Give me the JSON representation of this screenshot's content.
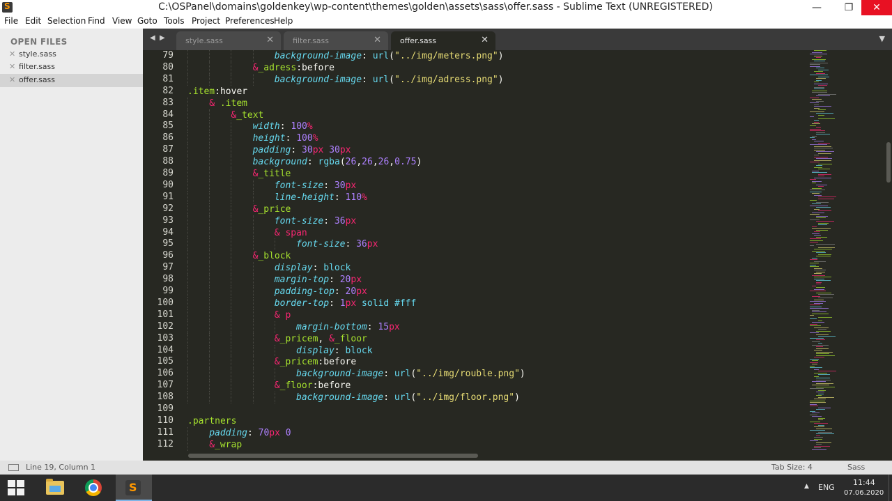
{
  "window": {
    "title": "C:\\OSPanel\\domains\\goldenkey\\wp-content\\themes\\golden\\assets\\sass\\offer.sass - Sublime Text (UNREGISTERED)",
    "minimize": "—",
    "maximize": "❐",
    "close": "✕"
  },
  "menu": [
    "File",
    "Edit",
    "Selection",
    "Find",
    "View",
    "Goto",
    "Tools",
    "Project",
    "Preferences",
    "Help"
  ],
  "sidebar": {
    "title": "OPEN FILES",
    "files": [
      {
        "name": "style.sass",
        "active": false
      },
      {
        "name": "filter.sass",
        "active": false
      },
      {
        "name": "offer.sass",
        "active": true
      }
    ],
    "close_glyph": "✕"
  },
  "tabs": [
    {
      "label": "style.sass",
      "active": false
    },
    {
      "label": "filter.sass",
      "active": false
    },
    {
      "label": "offer.sass",
      "active": true
    }
  ],
  "tab_close_glyph": "✕",
  "tab_nav": {
    "left": "◀",
    "right": "▶",
    "dropdown": "▼"
  },
  "editor": {
    "lines": [
      {
        "n": "79",
        "indent": 4,
        "tokens": [
          [
            "prop",
            "background-image"
          ],
          [
            "pl",
            ": "
          ],
          [
            "fn",
            "url"
          ],
          [
            "pl",
            "("
          ],
          [
            "str",
            "\"../img/meters.png\""
          ],
          [
            "pl",
            ")"
          ]
        ]
      },
      {
        "n": "80",
        "indent": 3,
        "tokens": [
          [
            "amp",
            "&"
          ],
          [
            "sel",
            "_adress"
          ],
          [
            "pl",
            ":before"
          ]
        ]
      },
      {
        "n": "81",
        "indent": 4,
        "tokens": [
          [
            "prop",
            "background-image"
          ],
          [
            "pl",
            ": "
          ],
          [
            "fn",
            "url"
          ],
          [
            "pl",
            "("
          ],
          [
            "str",
            "\"../img/adress.png\""
          ],
          [
            "pl",
            ")"
          ]
        ]
      },
      {
        "n": "82",
        "indent": 0,
        "tokens": [
          [
            "sel",
            ".item"
          ],
          [
            "pl",
            ":hover"
          ]
        ]
      },
      {
        "n": "83",
        "indent": 1,
        "tokens": [
          [
            "amp",
            "& "
          ],
          [
            "sel",
            ".item"
          ]
        ]
      },
      {
        "n": "84",
        "indent": 2,
        "tokens": [
          [
            "amp",
            "&"
          ],
          [
            "sel",
            "_text"
          ]
        ]
      },
      {
        "n": "85",
        "indent": 3,
        "tokens": [
          [
            "prop",
            "width"
          ],
          [
            "pl",
            ": "
          ],
          [
            "num",
            "100"
          ],
          [
            "unit",
            "%"
          ]
        ]
      },
      {
        "n": "86",
        "indent": 3,
        "tokens": [
          [
            "prop",
            "height"
          ],
          [
            "pl",
            ": "
          ],
          [
            "num",
            "100"
          ],
          [
            "unit",
            "%"
          ]
        ]
      },
      {
        "n": "87",
        "indent": 3,
        "tokens": [
          [
            "prop",
            "padding"
          ],
          [
            "pl",
            ": "
          ],
          [
            "num",
            "30"
          ],
          [
            "unit",
            "px"
          ],
          [
            "pl",
            " "
          ],
          [
            "num",
            "30"
          ],
          [
            "unit",
            "px"
          ]
        ]
      },
      {
        "n": "88",
        "indent": 3,
        "tokens": [
          [
            "prop",
            "background"
          ],
          [
            "pl",
            ": "
          ],
          [
            "fn",
            "rgba"
          ],
          [
            "pl",
            "("
          ],
          [
            "num",
            "26"
          ],
          [
            "pl",
            ","
          ],
          [
            "num",
            "26"
          ],
          [
            "pl",
            ","
          ],
          [
            "num",
            "26"
          ],
          [
            "pl",
            ","
          ],
          [
            "num",
            "0.75"
          ],
          [
            "pl",
            ")"
          ]
        ]
      },
      {
        "n": "89",
        "indent": 3,
        "tokens": [
          [
            "amp",
            "&"
          ],
          [
            "sel",
            "_title"
          ]
        ]
      },
      {
        "n": "90",
        "indent": 4,
        "tokens": [
          [
            "prop",
            "font-size"
          ],
          [
            "pl",
            ": "
          ],
          [
            "num",
            "30"
          ],
          [
            "unit",
            "px"
          ]
        ]
      },
      {
        "n": "91",
        "indent": 4,
        "tokens": [
          [
            "prop",
            "line-height"
          ],
          [
            "pl",
            ": "
          ],
          [
            "num",
            "110"
          ],
          [
            "unit",
            "%"
          ]
        ]
      },
      {
        "n": "92",
        "indent": 3,
        "tokens": [
          [
            "amp",
            "&"
          ],
          [
            "sel",
            "_price"
          ]
        ]
      },
      {
        "n": "93",
        "indent": 4,
        "tokens": [
          [
            "prop",
            "font-size"
          ],
          [
            "pl",
            ": "
          ],
          [
            "num",
            "36"
          ],
          [
            "unit",
            "px"
          ]
        ]
      },
      {
        "n": "94",
        "indent": 4,
        "tokens": [
          [
            "amp",
            "& "
          ],
          [
            "amp",
            "span"
          ]
        ]
      },
      {
        "n": "95",
        "indent": 5,
        "tokens": [
          [
            "prop",
            "font-size"
          ],
          [
            "pl",
            ": "
          ],
          [
            "num",
            "36"
          ],
          [
            "unit",
            "px"
          ]
        ]
      },
      {
        "n": "96",
        "indent": 3,
        "tokens": [
          [
            "amp",
            "&"
          ],
          [
            "sel",
            "_block"
          ]
        ]
      },
      {
        "n": "97",
        "indent": 4,
        "tokens": [
          [
            "prop",
            "display"
          ],
          [
            "pl",
            ": "
          ],
          [
            "val",
            "block"
          ]
        ]
      },
      {
        "n": "98",
        "indent": 4,
        "tokens": [
          [
            "prop",
            "margin-top"
          ],
          [
            "pl",
            ": "
          ],
          [
            "num",
            "20"
          ],
          [
            "unit",
            "px"
          ]
        ]
      },
      {
        "n": "99",
        "indent": 4,
        "tokens": [
          [
            "prop",
            "padding-top"
          ],
          [
            "pl",
            ": "
          ],
          [
            "num",
            "20"
          ],
          [
            "unit",
            "px"
          ]
        ]
      },
      {
        "n": "100",
        "indent": 4,
        "tokens": [
          [
            "prop",
            "border-top"
          ],
          [
            "pl",
            ": "
          ],
          [
            "num",
            "1"
          ],
          [
            "unit",
            "px"
          ],
          [
            "pl",
            " "
          ],
          [
            "val",
            "solid"
          ],
          [
            "pl",
            " "
          ],
          [
            "val",
            "#fff"
          ]
        ]
      },
      {
        "n": "101",
        "indent": 4,
        "tokens": [
          [
            "amp",
            "& "
          ],
          [
            "amp",
            "p"
          ]
        ]
      },
      {
        "n": "102",
        "indent": 5,
        "tokens": [
          [
            "prop",
            "margin-bottom"
          ],
          [
            "pl",
            ": "
          ],
          [
            "num",
            "15"
          ],
          [
            "unit",
            "px"
          ]
        ]
      },
      {
        "n": "103",
        "indent": 4,
        "tokens": [
          [
            "amp",
            "&"
          ],
          [
            "sel",
            "_pricem"
          ],
          [
            "pl",
            ", "
          ],
          [
            "amp",
            "&"
          ],
          [
            "sel",
            "_floor"
          ]
        ]
      },
      {
        "n": "104",
        "indent": 5,
        "tokens": [
          [
            "prop",
            "display"
          ],
          [
            "pl",
            ": "
          ],
          [
            "val",
            "block"
          ]
        ]
      },
      {
        "n": "105",
        "indent": 4,
        "tokens": [
          [
            "amp",
            "&"
          ],
          [
            "sel",
            "_pricem"
          ],
          [
            "pl",
            ":before"
          ]
        ]
      },
      {
        "n": "106",
        "indent": 5,
        "tokens": [
          [
            "prop",
            "background-image"
          ],
          [
            "pl",
            ": "
          ],
          [
            "fn",
            "url"
          ],
          [
            "pl",
            "("
          ],
          [
            "str",
            "\"../img/rouble.png\""
          ],
          [
            "pl",
            ")"
          ]
        ]
      },
      {
        "n": "107",
        "indent": 4,
        "tokens": [
          [
            "amp",
            "&"
          ],
          [
            "sel",
            "_floor"
          ],
          [
            "pl",
            ":before"
          ]
        ]
      },
      {
        "n": "108",
        "indent": 5,
        "tokens": [
          [
            "prop",
            "background-image"
          ],
          [
            "pl",
            ": "
          ],
          [
            "fn",
            "url"
          ],
          [
            "pl",
            "("
          ],
          [
            "str",
            "\"../img/floor.png\""
          ],
          [
            "pl",
            ")"
          ]
        ]
      },
      {
        "n": "109",
        "indent": 0,
        "tokens": []
      },
      {
        "n": "110",
        "indent": 0,
        "tokens": [
          [
            "sel",
            ".partners"
          ]
        ]
      },
      {
        "n": "111",
        "indent": 1,
        "tokens": [
          [
            "prop",
            "padding"
          ],
          [
            "pl",
            ": "
          ],
          [
            "num",
            "70"
          ],
          [
            "unit",
            "px"
          ],
          [
            "pl",
            " "
          ],
          [
            "num",
            "0"
          ]
        ]
      },
      {
        "n": "112",
        "indent": 1,
        "tokens": [
          [
            "amp",
            "&"
          ],
          [
            "sel",
            "_wrap"
          ]
        ]
      }
    ]
  },
  "colors": {
    "selector": "#a6e22e",
    "ampersand": "#f92672",
    "property": "#66d9ef",
    "number": "#ae81ff",
    "string": "#e6db74",
    "editor_bg": "#272822"
  },
  "status": {
    "position": "Line 19, Column 1",
    "tab_size": "Tab Size: 4",
    "syntax": "Sass"
  },
  "taskbar": {
    "apps": [
      {
        "name": "start",
        "icon": "windows-logo-icon"
      },
      {
        "name": "explorer",
        "icon": "folder-icon"
      },
      {
        "name": "chrome",
        "icon": "chrome-icon"
      },
      {
        "name": "sublime",
        "icon": "sublime-text-icon",
        "active": true
      }
    ],
    "tray_arrow": "▲",
    "language": "ENG",
    "time": "11:44",
    "date": "07.06.2020"
  }
}
